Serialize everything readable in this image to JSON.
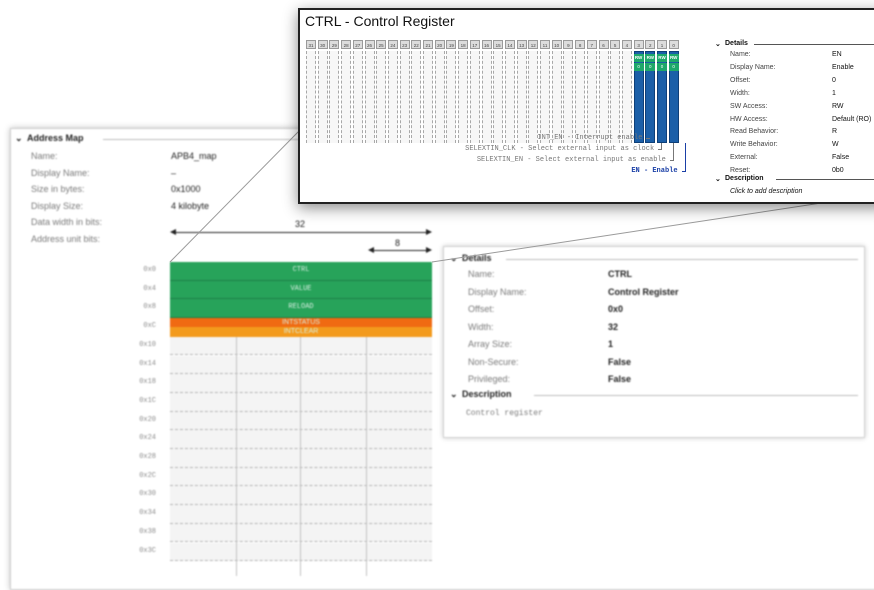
{
  "address_map": {
    "section_title": "Address Map",
    "fields": [
      {
        "label": "Name:",
        "value": "APB4_map"
      },
      {
        "label": "Display Name:",
        "value": "–"
      },
      {
        "label": "Size in bytes:",
        "value": "0x1000"
      },
      {
        "label": "Display Size:",
        "value": "4 kilobyte"
      },
      {
        "label": "Data width in bits:",
        "value": ""
      },
      {
        "label": "Address unit bits:",
        "value": ""
      }
    ],
    "width_label": "32",
    "unit_label": "8",
    "addresses": [
      "0x0",
      "0x4",
      "0x8",
      "0xC",
      "0x10",
      "0x14",
      "0x18",
      "0x1C",
      "0x20",
      "0x24",
      "0x28",
      "0x2C",
      "0x30",
      "0x34",
      "0x38",
      "0x3C"
    ],
    "registers": [
      {
        "name": "CTRL",
        "color": "#27a35a"
      },
      {
        "name": "VALUE",
        "color": "#27a35a"
      },
      {
        "name": "RELOAD",
        "color": "#27a35a"
      },
      {
        "name": "INTSTATUS",
        "name2": "INTCLEAR",
        "color": "#f06a12",
        "color2": "#f39a1c"
      }
    ]
  },
  "register_details": {
    "section_title": "Details",
    "fields": [
      {
        "label": "Name:",
        "value": "CTRL"
      },
      {
        "label": "Display Name:",
        "value": "Control Register"
      },
      {
        "label": "Offset:",
        "value": "0x0"
      },
      {
        "label": "Width:",
        "value": "32"
      },
      {
        "label": "Array Size:",
        "value": "1"
      },
      {
        "label": "Non-Secure:",
        "value": "False"
      },
      {
        "label": "Privileged:",
        "value": "False"
      }
    ],
    "description_title": "Description",
    "description": "Control register"
  },
  "popup": {
    "title": "CTRL - Control Register",
    "bit_numbers": [
      "31",
      "30",
      "29",
      "28",
      "27",
      "26",
      "25",
      "24",
      "23",
      "22",
      "21",
      "20",
      "19",
      "18",
      "17",
      "16",
      "15",
      "14",
      "13",
      "12",
      "11",
      "10",
      "9",
      "8",
      "7",
      "6",
      "5",
      "4",
      "3",
      "2",
      "1",
      "0"
    ],
    "access_labels": [
      "RW",
      "RW",
      "RW",
      "RW"
    ],
    "reset_labels": [
      "0",
      "0",
      "0",
      "0"
    ],
    "fields": [
      {
        "label": "INT_EN - Interrupt enable",
        "active": false
      },
      {
        "label": "SELEXTIN_CLK - Select external input as clock",
        "active": false
      },
      {
        "label": "SELEXTIN_EN - Select external input as enable",
        "active": false
      },
      {
        "label": "EN - Enable",
        "active": true
      }
    ],
    "details_title": "Details",
    "details": [
      {
        "label": "Name:",
        "value": "EN"
      },
      {
        "label": "Display Name:",
        "value": "Enable"
      },
      {
        "label": "Offset:",
        "value": "0"
      },
      {
        "label": "Width:",
        "value": "1"
      },
      {
        "label": "SW Access:",
        "value": "RW"
      },
      {
        "label": "HW Access:",
        "value": "Default (RO)"
      },
      {
        "label": "Read Behavior:",
        "value": "R"
      },
      {
        "label": "Write Behavior:",
        "value": "W"
      },
      {
        "label": "External:",
        "value": "False"
      },
      {
        "label": "Reset:",
        "value": "0b0"
      }
    ],
    "description_title": "Description",
    "description_placeholder": "Click to add description",
    "colors": {
      "bit_field": "#1b5fa8",
      "access": "#1ea86a",
      "active_label": "#1a3fa6"
    }
  }
}
